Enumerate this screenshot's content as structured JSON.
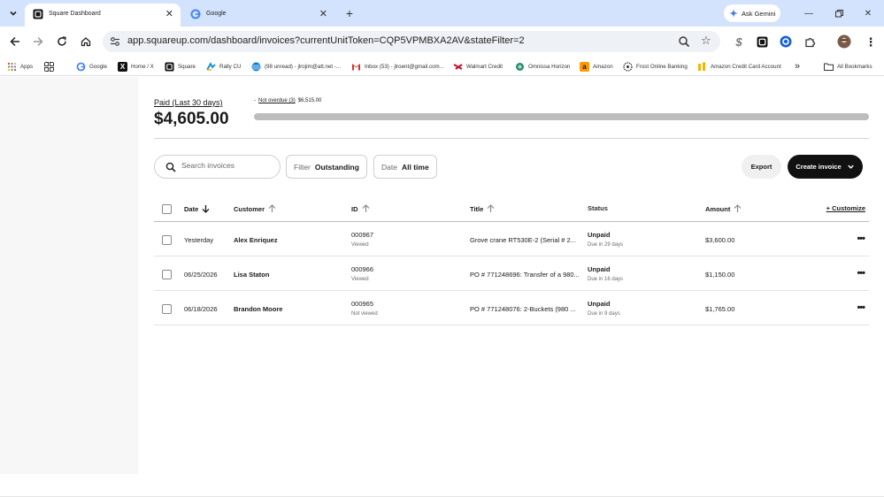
{
  "browser": {
    "tabs": [
      {
        "title": "Square Dashboard",
        "active": true
      },
      {
        "title": "Google",
        "active": false
      }
    ],
    "ask_gemini_label": "Ask Gemini",
    "url": "app.squareup.com/dashboard/invoices?currentUnitToken=CQP5VPMBXA2AV&stateFilter=2",
    "bookmarks": [
      {
        "label": "Apps",
        "icon": "apps-grid-icon"
      },
      {
        "label": "",
        "icon": "tab-groups-icon"
      },
      {
        "label": "Google",
        "icon": "google-icon"
      },
      {
        "label": "Home / X",
        "icon": "x-icon"
      },
      {
        "label": "Square",
        "icon": "square-icon"
      },
      {
        "label": "Rally CU",
        "icon": "rally-icon"
      },
      {
        "label": "(98 unread) - jlrojim@att.net -...",
        "icon": "att-icon"
      },
      {
        "label": "Inbox (53) - jlroent@gmail.com...",
        "icon": "gmail-icon"
      },
      {
        "label": "Walmart Credit",
        "icon": "walmart-credit-icon"
      },
      {
        "label": "Omnissa Horizon",
        "icon": "omnissa-icon"
      },
      {
        "label": "Amazon",
        "icon": "amazon-icon"
      },
      {
        "label": "Frost Online Banking",
        "icon": "frost-icon"
      },
      {
        "label": "Amazon Credit Card Account",
        "icon": "amazon-card-icon"
      }
    ],
    "bookmarks_overflow": "»",
    "all_bookmarks_label": "All Bookmarks"
  },
  "summary": {
    "paid_label": "Paid (Last 30 days)",
    "paid_amount": "$4,605.00",
    "not_overdue_label": "Not overdue (3)",
    "not_overdue_amount": "$6,515.00",
    "progress_fraction": 1.0
  },
  "toolbar": {
    "search_placeholder": "Search invoices",
    "filter_key": "Filter",
    "filter_value": "Outstanding",
    "date_key": "Date",
    "date_value": "All time",
    "export_label": "Export",
    "create_label": "Create invoice"
  },
  "table": {
    "columns": {
      "date": "Date",
      "customer": "Customer",
      "id": "ID",
      "title": "Title",
      "status": "Status",
      "amount": "Amount"
    },
    "customize_label": "+ Customize",
    "rows": [
      {
        "date": "Yesterday",
        "customer": "Alex Enriquez",
        "id": "000967",
        "id_sub": "Viewed",
        "title": "Grove crane RT530E-2 (Serial # 2...",
        "status": "Unpaid",
        "status_sub": "Due in 29 days",
        "amount": "$3,600.00"
      },
      {
        "date": "06/25/2026",
        "customer": "Lisa Staton",
        "id": "000966",
        "id_sub": "Viewed",
        "title": "PO # 771248696: Transfer of a 980...",
        "status": "Unpaid",
        "status_sub": "Due in 16 days",
        "amount": "$1,150.00"
      },
      {
        "date": "06/18/2026",
        "customer": "Brandon Moore",
        "id": "000965",
        "id_sub": "Not viewed",
        "title": "PO # 771248076: 2-Buckets (980 ...",
        "status": "Unpaid",
        "status_sub": "Due in 9 days",
        "amount": "$1,765.00"
      }
    ]
  }
}
